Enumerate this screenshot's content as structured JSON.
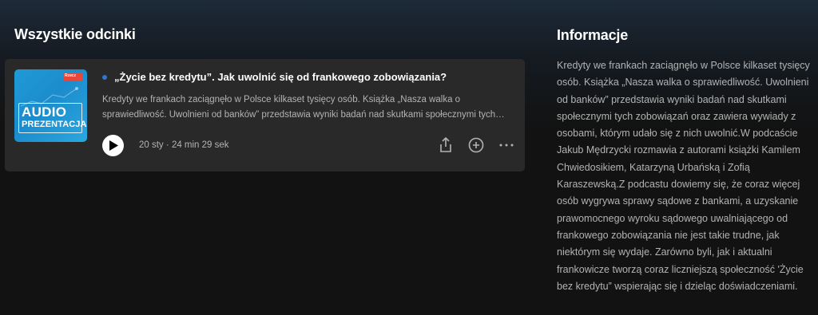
{
  "episodes": {
    "section_title": "Wszystkie odcinki",
    "items": [
      {
        "title": "„Życie bez kredytu”. Jak uwolnić się od frankowego zobowiązania?",
        "description": "Kredyty we frankach zaciągnęło w Polsce kilkaset tysięcy osób. Książka „Nasza walka o sprawiedliwość. Uwolnieni od banków” przedstawia wyniki badań nad skutkami społecznymi tych…",
        "date": "20 sty",
        "separator": "·",
        "duration": "24 min 29 sek",
        "is_new": true,
        "cover": {
          "line1": "AUDIO",
          "line2": "PREZENTACJA",
          "badge": "Rzecz",
          "colors": {
            "background": "#1f9bd6",
            "badge": "#e8463a"
          }
        },
        "actions": [
          "share-icon",
          "add-icon",
          "more-icon"
        ]
      }
    ]
  },
  "info": {
    "section_title": "Informacje",
    "text": "Kredyty we frankach zaciągnęło w Polsce kilkaset tysięcy osób. Książka „Nasza walka o sprawiedliwość. Uwolnieni od banków” przedstawia wyniki badań nad skutkami społecznymi tych zobowiązań oraz zawiera wywiady z osobami, którym udało się z nich uwolnić.W podcaście Jakub Mędrzycki rozmawia z autorami książki Kamilem Chwiedosikiem, Katarzyną Urbańską i Zofią Karaszewską.Z podcastu dowiemy się, że coraz więcej osób wygrywa sprawy sądowe z bankami, a uzyskanie prawomocnego wyroku sądowego uwalniającego od frankowego zobowiązania nie jest takie trudne, jak niektórym się wydaje. Zarówno byli, jak i aktualni frankowicze tworzą coraz liczniejszą społeczność 'Życie bez kredytu” wspierając się i dzieląc doświadczeniami."
  },
  "colors": {
    "background": "#121212",
    "card": "#292929",
    "text_primary": "#ffffff",
    "text_secondary": "#b3b3b3",
    "new_dot": "#2e77d0"
  }
}
